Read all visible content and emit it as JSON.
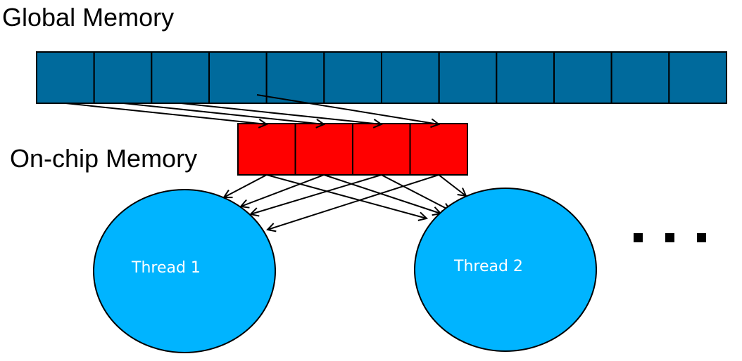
{
  "labels": {
    "global_memory": "Global Memory",
    "onchip_memory": "On-chip Memory"
  },
  "global_memory": {
    "cell_count": 12,
    "color": "#006a9c"
  },
  "onchip_memory": {
    "cell_count": 4,
    "color": "#ff0000"
  },
  "threads": [
    {
      "label": "Thread 1",
      "color": "#00b4ff"
    },
    {
      "label": "Thread 2",
      "color": "#00b4ff"
    }
  ],
  "ellipsis": {
    "dot_count": 3,
    "meaning": "more threads"
  },
  "load_arrows": [
    {
      "from_global_cell": 1,
      "to_onchip_cell": 1
    },
    {
      "from_global_cell": 2,
      "to_onchip_cell": 2
    },
    {
      "from_global_cell": 3,
      "to_onchip_cell": 3
    },
    {
      "from_global_cell": 4,
      "to_onchip_cell": 4
    }
  ],
  "thread_access_arrows": [
    {
      "from_onchip_cell": 1,
      "to_thread": 1
    },
    {
      "from_onchip_cell": 2,
      "to_thread": 1
    },
    {
      "from_onchip_cell": 3,
      "to_thread": 1
    },
    {
      "from_onchip_cell": 4,
      "to_thread": 1
    },
    {
      "from_onchip_cell": 1,
      "to_thread": 2
    },
    {
      "from_onchip_cell": 2,
      "to_thread": 2
    },
    {
      "from_onchip_cell": 3,
      "to_thread": 2
    },
    {
      "from_onchip_cell": 4,
      "to_thread": 2
    }
  ]
}
